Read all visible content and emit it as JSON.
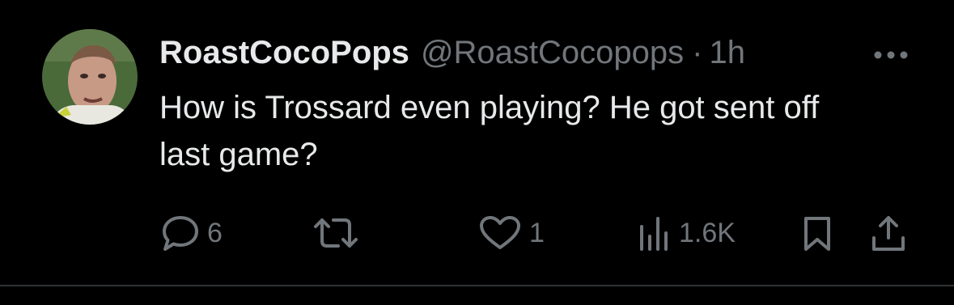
{
  "tweet": {
    "display_name": "RoastCocoPops",
    "handle": "@RoastCocopops",
    "separator": "·",
    "time": "1h",
    "text": "How is Trossard even playing? He got sent off\nlast game?",
    "avatar_icon": "profile-photo-avatar",
    "more_icon": "more-horizontal-icon"
  },
  "actions": {
    "reply": {
      "icon": "reply-bubble-icon",
      "count": "6"
    },
    "retweet": {
      "icon": "retweet-icon",
      "count": ""
    },
    "like": {
      "icon": "heart-icon",
      "count": "1"
    },
    "views": {
      "icon": "views-bar-chart-icon",
      "count": "1.6K"
    },
    "bookmark": {
      "icon": "bookmark-icon"
    },
    "share": {
      "icon": "share-upload-icon"
    }
  },
  "colors": {
    "background": "#000000",
    "primary_text": "#e7e9ea",
    "secondary_text": "#71767b",
    "divider": "#2f3336"
  }
}
